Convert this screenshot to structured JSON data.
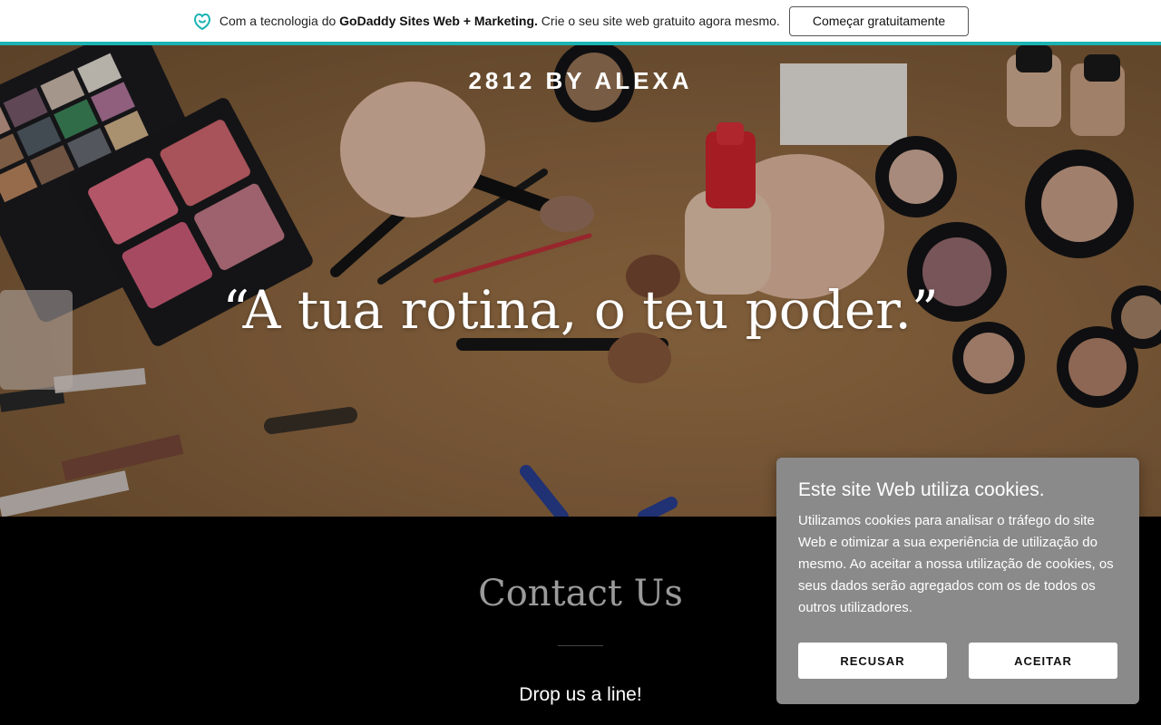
{
  "promo": {
    "text_prefix": "Com a tecnologia do ",
    "text_brand": "GoDaddy Sites Web + Marketing.",
    "text_suffix": " Crie o seu site web gratuito agora mesmo.",
    "cta_label": "Começar gratuitamente",
    "logo_icon": "godaddy-logo-icon",
    "accent_color": "#1bb3b3"
  },
  "hero": {
    "brand": "2812 BY ALEXA",
    "quote": "“A tua rotina, o teu poder.”"
  },
  "contact": {
    "title": "Contact Us",
    "subtitle": "Drop us a line!"
  },
  "cookie": {
    "title": "Este site Web utiliza cookies.",
    "body": "Utilizamos cookies para analisar o tráfego do site Web e otimizar a sua experiência de utilização do mesmo. Ao aceitar a nossa utilização de cookies, os seus dados serão agregados com os de todos os outros utilizadores.",
    "decline_label": "RECUSAR",
    "accept_label": "ACEITAR"
  }
}
